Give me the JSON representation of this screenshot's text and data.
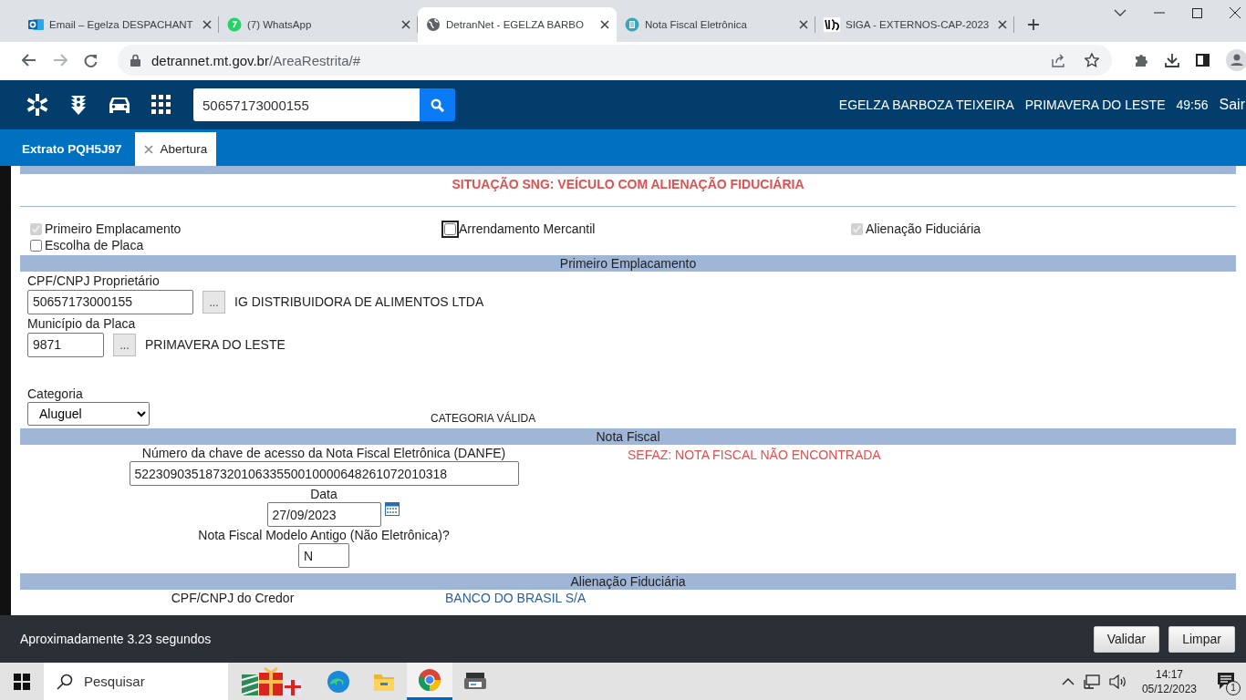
{
  "browser": {
    "tabs": [
      {
        "title": "Email – Egelza DESPACHANT",
        "selected": false
      },
      {
        "title": "(7) WhatsApp",
        "selected": false
      },
      {
        "title": "DetranNet - EGELZA BARBO",
        "selected": true
      },
      {
        "title": "Nota Fiscal Eletrônica",
        "selected": false
      },
      {
        "title": "SIGA - EXTERNOS-CAP-2023",
        "selected": false
      }
    ],
    "url_host": "detrannet.mt.gov.br",
    "url_path": "/AreaRestrita/#"
  },
  "app_header": {
    "search_value": "50657173000155",
    "user": "EGELZA BARBOZA TEIXEIRA",
    "city": "PRIMAVERA DO LESTE",
    "timer": "49:56",
    "logout": "Sair"
  },
  "page_tabs": [
    {
      "label": "Extrato PQH5J97",
      "selected": false,
      "closable": false
    },
    {
      "label": "Abertura",
      "selected": true,
      "closable": true
    }
  ],
  "alert": "SITUAÇÃO SNG: VEÍCULO COM ALIENAÇÃO FIDUCIÁRIA",
  "options": [
    {
      "label": "Primeiro Emplacamento",
      "checked": true,
      "disabled": true
    },
    {
      "label": "Arrendamento Mercantil",
      "checked": false,
      "disabled": false
    },
    {
      "label": "Alienação Fiduciária",
      "checked": true,
      "disabled": true
    },
    {
      "label": "Escolha de Placa",
      "checked": false,
      "disabled": false
    }
  ],
  "primeiro_emplacamento": {
    "title": "Primeiro Emplacamento",
    "owner_label": "CPF/CNPJ Proprietário",
    "owner_value": "50657173000155",
    "owner_lookup": "...",
    "owner_name": "IG DISTRIBUIDORA DE ALIMENTOS LTDA",
    "city_label": "Município da Placa",
    "city_value": "9871",
    "city_lookup": "...",
    "city_name": "PRIMAVERA DO LESTE",
    "category_label": "Categoria",
    "category_value": "Aluguel",
    "category_status": "CATEGORIA VÁLIDA"
  },
  "nota_fiscal": {
    "title": "Nota Fiscal",
    "key_label": "Número da chave de acesso da Nota Fiscal Eletrônica (DANFE)",
    "key_value": "52230903518732010633550010000648261072010318",
    "date_label": "Data",
    "date_value": "27/09/2023",
    "old_model_label": "Nota Fiscal Modelo Antigo (Não Eletrônica)?",
    "old_model_value": "N",
    "sefaz_message": "SEFAZ: NOTA FISCAL NÃO ENCONTRADA"
  },
  "alienacao": {
    "title": "Alienação Fiduciária",
    "creditor_label": "CPF/CNPJ do Credor",
    "creditor_name": "BANCO DO BRASIL S/A"
  },
  "footer": {
    "status": "Aproximadamente 3.23 segundos",
    "buttons": [
      "Validar",
      "Limpar"
    ]
  },
  "taskbar": {
    "search_placeholder": "Pesquisar",
    "apps": [
      {
        "selected": false
      },
      {
        "selected": false
      },
      {
        "selected": true
      },
      {
        "selected": false
      }
    ],
    "time": "14:17",
    "date": "05/12/2023",
    "notifications": "1"
  }
}
